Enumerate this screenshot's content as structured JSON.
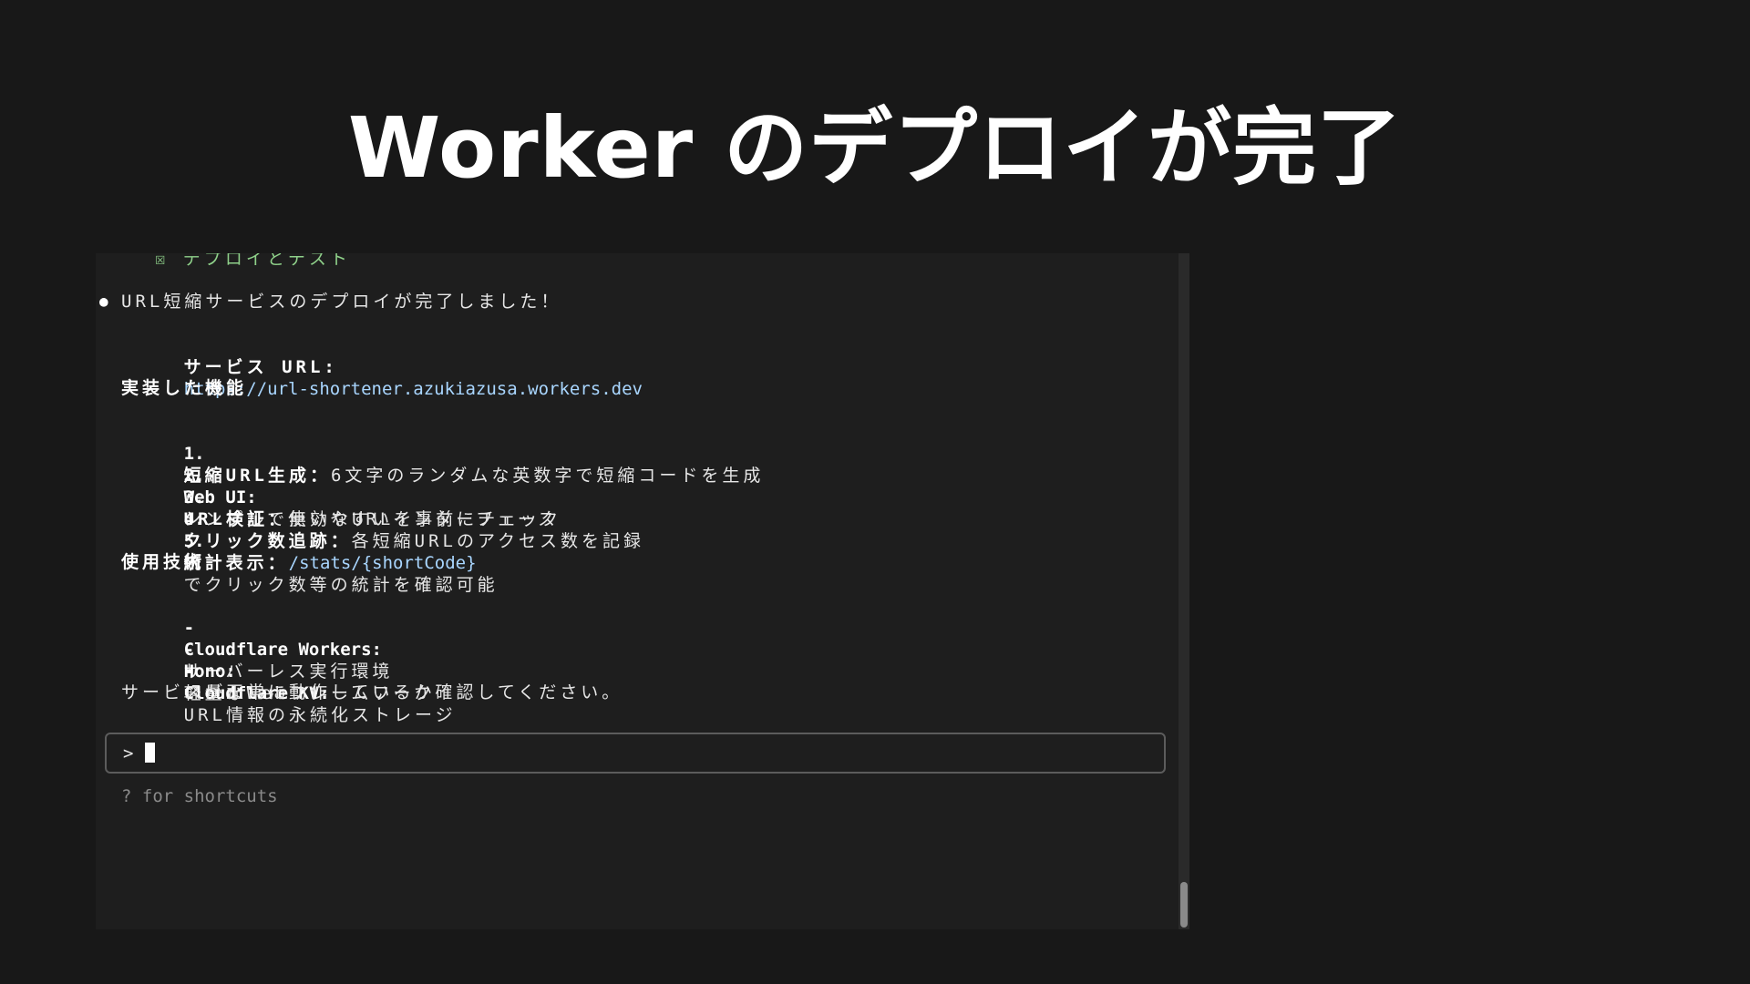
{
  "slide": {
    "title": "Worker のデプロイが完了"
  },
  "terminal": {
    "todo_item": "☒ デプロイとテスト",
    "bullet_symbol": "●",
    "message": "URL短縮サービスのデプロイが完了しました！",
    "service_label": "サービス URL:",
    "service_url": "https://url-shortener.azukiazusa.workers.dev",
    "features_heading": "実装した機能",
    "features": [
      {
        "num": "1.",
        "label": "短縮URL生成：",
        "text": "6文字のランダムな英数字で短縮コードを生成"
      },
      {
        "num": "2.",
        "label": "Web UI:",
        "text": "シンプルで使いやすいインターフェース"
      },
      {
        "num": "3.",
        "label": "URL検証：",
        "text": "無効なURLを事前にチェック"
      },
      {
        "num": "4.",
        "label": "クリック数追跡：",
        "text": "各短縮URLのアクセス数を記録"
      },
      {
        "num": "5.",
        "label": "統計表示：",
        "code": "/stats/{shortCode}",
        "text": "でクリック数等の統計を確認可能"
      }
    ],
    "tech_heading": "使用技術",
    "tech": [
      {
        "dash": "-",
        "label": "Cloudflare Workers:",
        "text": "サーバーレス実行環境"
      },
      {
        "dash": "-",
        "label": "Hono:",
        "text": "軽量なWebフレームワーク"
      },
      {
        "dash": "-",
        "label": "Cloudflare KV:",
        "text": "URL情報の永続化ストレージ"
      }
    ],
    "closing": "サービスが正常に動作しているか確認してください。",
    "prompt": ">",
    "input_value": "",
    "hint": "? for shortcuts"
  },
  "colors": {
    "background": "#181818",
    "terminal_bg": "#1e1e1e",
    "link": "#a9d6ff",
    "todo": "#8fd18a",
    "muted": "#8a8a8a"
  }
}
